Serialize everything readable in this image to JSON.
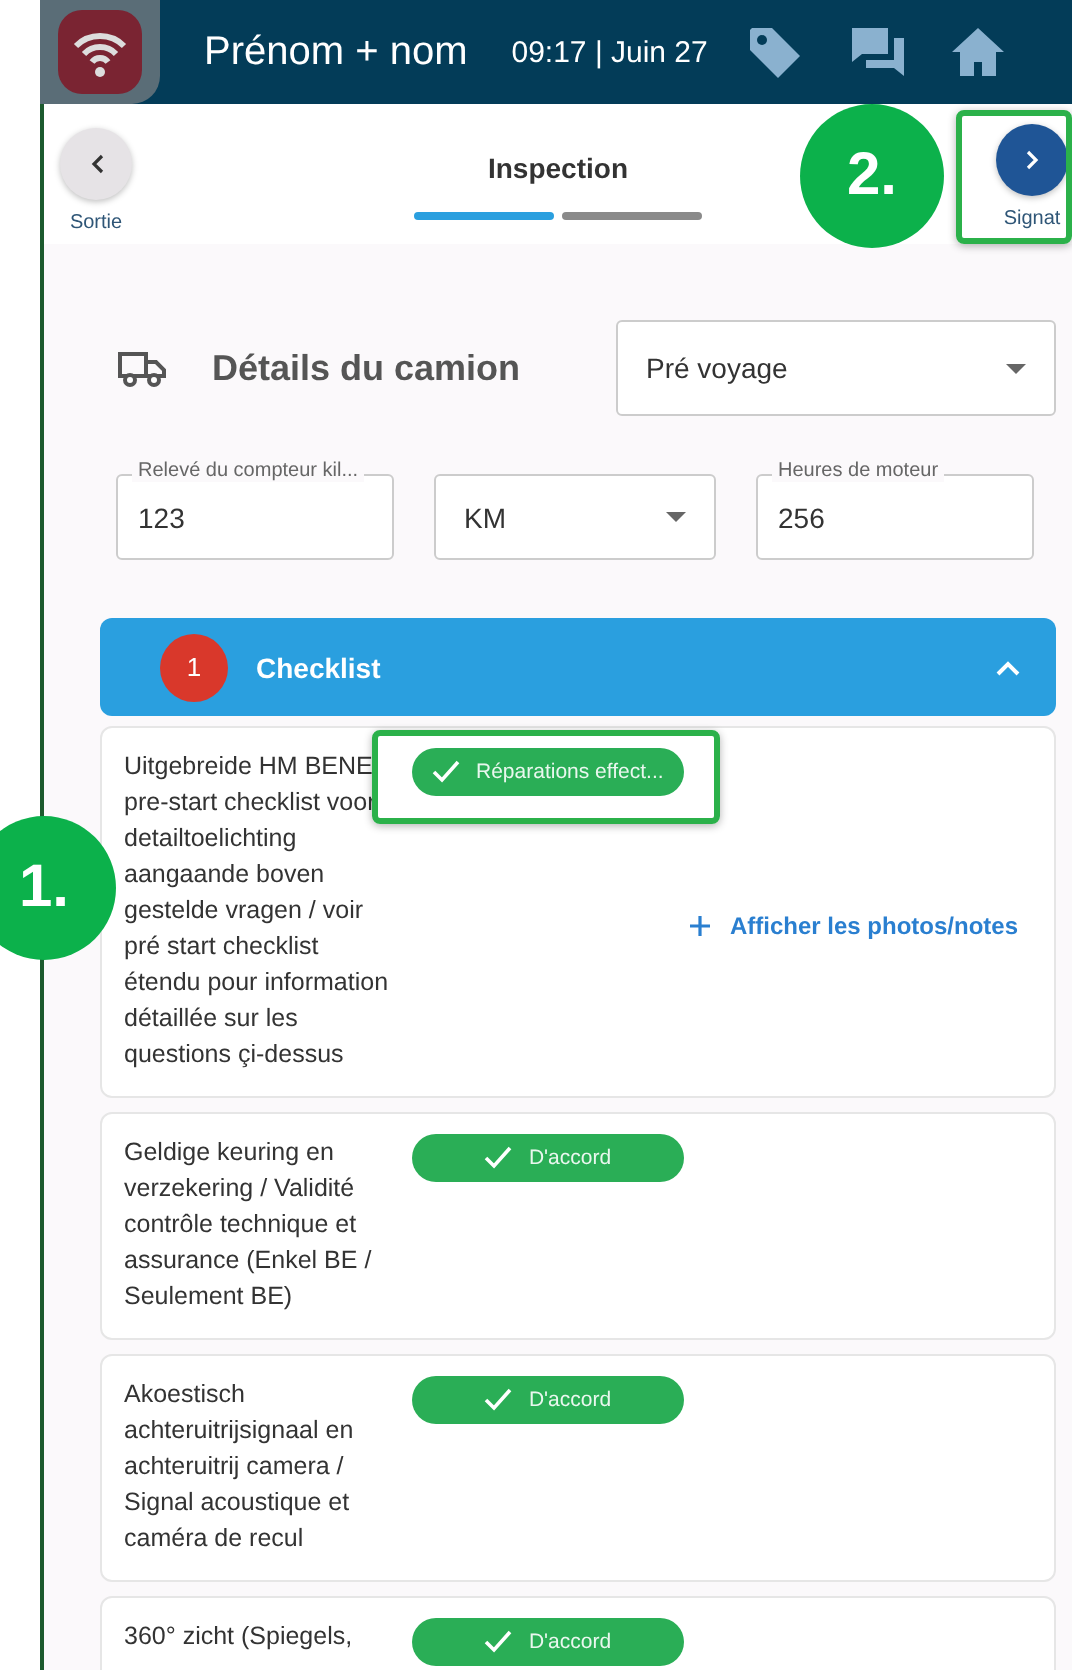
{
  "header": {
    "user_name": "Prénom + nom",
    "datetime": "09:17 | Juin 27"
  },
  "nav": {
    "back_label": "Sortie",
    "title": "Inspection",
    "next_label": "Signat",
    "steps": [
      {
        "selected": true
      },
      {
        "selected": false
      }
    ]
  },
  "truck_details": {
    "title": "Détails du camion",
    "trip_type": "Pré voyage",
    "odometer": {
      "label": "Relevé du compteur kil...",
      "value": "123"
    },
    "unit": "KM",
    "engine_hours": {
      "label": "Heures de moteur",
      "value": "256"
    }
  },
  "checklist": {
    "badge": "1",
    "title": "Checklist",
    "expanded": true,
    "items": [
      {
        "text": "Uitgebreide HM BENE pre-start checklist voor detailtoelichting aangaande boven gestelde vragen / voir pré start checklist étendu pour information détaillée sur les questions çi-dessus",
        "status": "Réparations effect...",
        "link": "Afficher les photos/notes"
      },
      {
        "text": "Geldige keuring en verzekering / Validité contrôle technique et assurance (Enkel BE / Seulement BE)",
        "status": "D'accord"
      },
      {
        "text": "Akoestisch achteruitrijsignaal en achteruitrij camera / Signal acoustique et caméra de recul",
        "status": "D'accord"
      },
      {
        "text": "360° zicht (Spiegels,",
        "status": "D'accord"
      }
    ]
  },
  "annotations": [
    {
      "label": "1."
    },
    {
      "label": "2."
    }
  ]
}
